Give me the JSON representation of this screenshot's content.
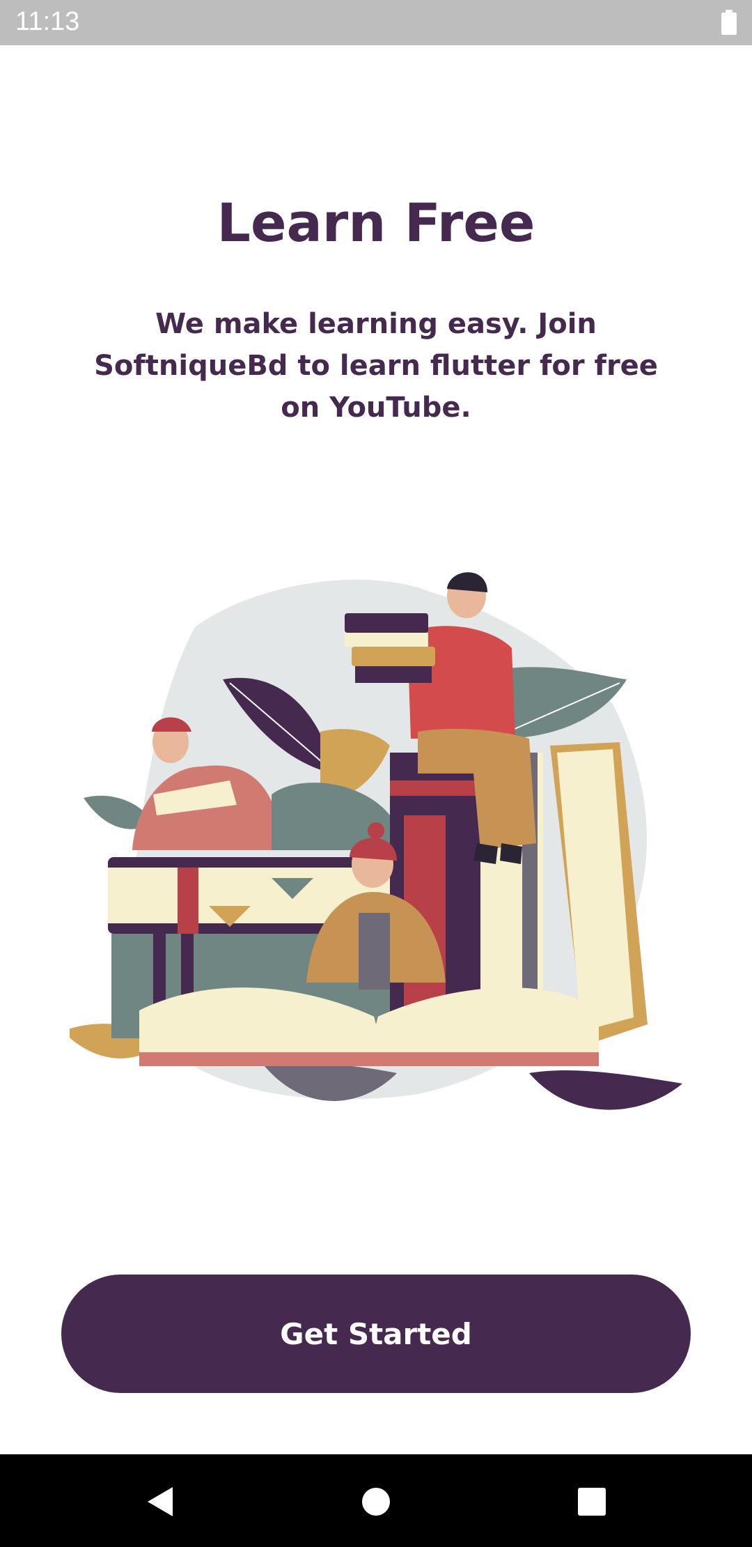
{
  "status_bar": {
    "time": "11:13",
    "battery_icon": "battery-full-icon"
  },
  "onboarding": {
    "title": "Learn Free",
    "subtitle": "We make learning easy. Join SoftniqueBd to learn flutter for free on YouTube."
  },
  "illustration": {
    "icon": "reading-people-books-illustration"
  },
  "cta": {
    "label": "Get Started"
  },
  "nav_bar": {
    "back_icon": "back-triangle-icon",
    "home_icon": "home-circle-icon",
    "recents_icon": "recents-square-icon"
  },
  "colors": {
    "primary": "#46294f",
    "status_bar": "#bdbdbd",
    "nav_bar": "#000000",
    "background": "#ffffff"
  }
}
